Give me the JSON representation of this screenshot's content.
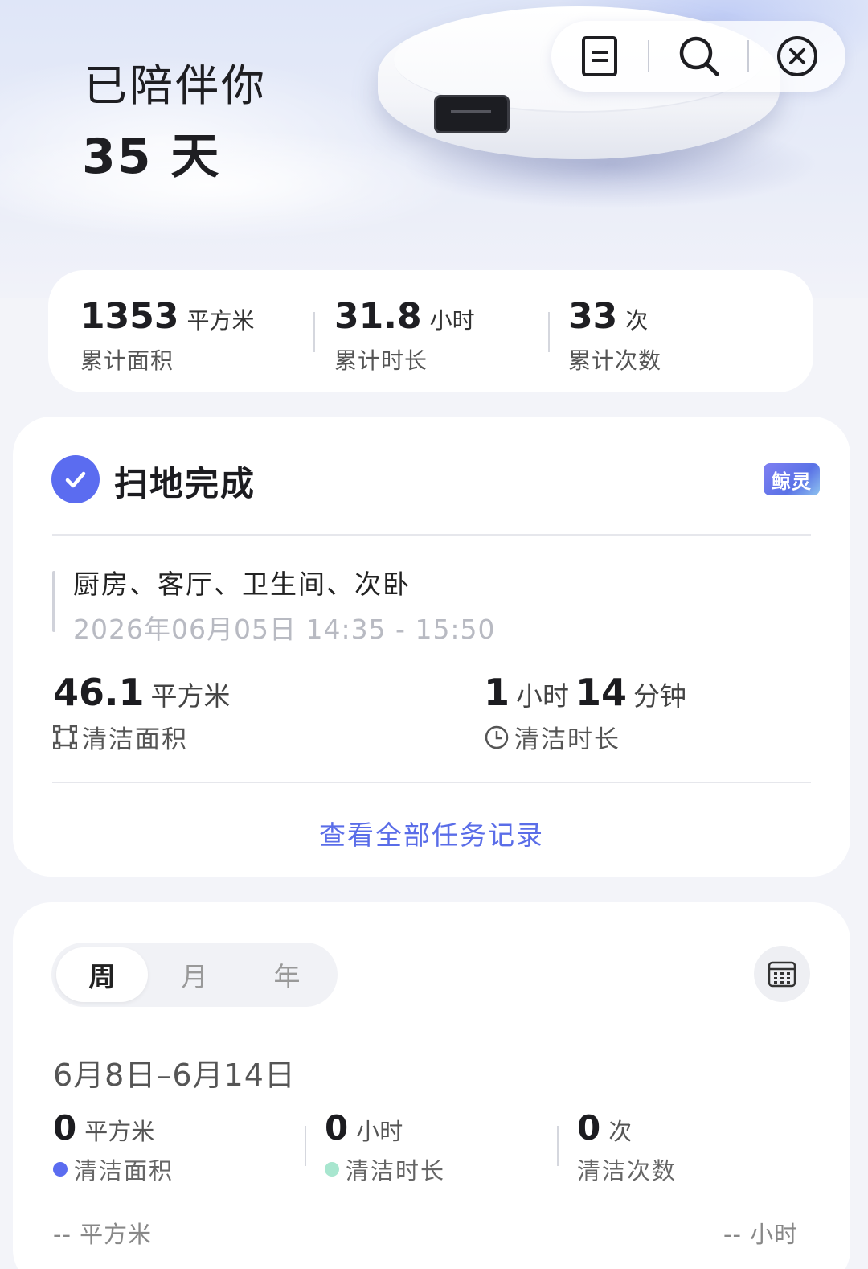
{
  "hero": {
    "title": "已陪伴你",
    "days": "35 天"
  },
  "top_actions": [
    {
      "icon": "document-icon"
    },
    {
      "icon": "search-icon"
    },
    {
      "icon": "close-circle-icon"
    }
  ],
  "summary": {
    "area": {
      "value": "1353",
      "unit": "平方米",
      "label": "累计面积"
    },
    "duration": {
      "value": "31.8",
      "unit": "小时",
      "label": "累计时长"
    },
    "count": {
      "value": "33",
      "unit": "次",
      "label": "累计次数"
    }
  },
  "last_task": {
    "status": "扫地完成",
    "badge": "鲸灵",
    "rooms": "厨房、客厅、卫生间、次卧",
    "time_range": "2026年06月05日 14:35 - 15:50",
    "area": {
      "value": "46.1",
      "unit": "平方米",
      "label": "清洁面积"
    },
    "duration": {
      "hours": "1",
      "hours_unit": "小时",
      "minutes": "14",
      "minutes_unit": "分钟",
      "label": "清洁时长"
    },
    "link": "查看全部任务记录"
  },
  "report": {
    "tabs": [
      "周",
      "月",
      "年"
    ],
    "active_tab": "周",
    "date_range": "6月8日–6月14日",
    "area": {
      "value": "0",
      "unit": "平方米",
      "label": "清洁面积"
    },
    "duration": {
      "value": "0",
      "unit": "小时",
      "label": "清洁时长"
    },
    "count": {
      "value": "0",
      "unit": "次",
      "label": "清洁次数"
    },
    "axis_left": "-- 平方米",
    "axis_right": "-- 小时"
  },
  "colors": {
    "accent": "#5b6cf0",
    "link": "#5a6de8",
    "area_dot": "#5b6cf0",
    "duration_dot": "#a8e6cf"
  }
}
